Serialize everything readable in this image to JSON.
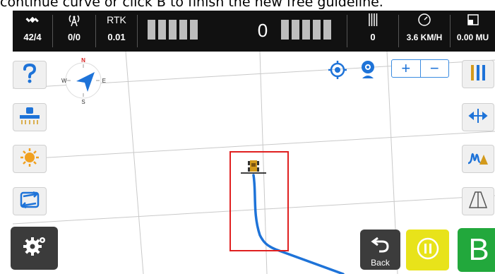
{
  "instruction": "continue curve or click B to finish the new free guideline.",
  "status_bar": {
    "satellites": "42/4",
    "signal": "0/0",
    "rtk_label": "RTK",
    "rtk_value": "0.01",
    "offset_center": "0",
    "row_count": "0",
    "speed": "3.6 KM/H",
    "area": "0.00 MU"
  },
  "map_toolbar": {
    "zoom_in": "+",
    "zoom_out": "−"
  },
  "compass": {
    "north": "N",
    "east": "E",
    "south": "S",
    "west": "W"
  },
  "bottom_controls": {
    "back_label": "Back",
    "b_label": "B"
  },
  "colors": {
    "track": "#1e73d8",
    "selection": "#e02020",
    "pause_bg": "#e8e31a",
    "b_bg": "#22a83c"
  },
  "icons": {
    "left_panel": [
      "help-icon",
      "implement-icon",
      "brightness-icon",
      "guideline-switch-icon",
      "settings-gear-icon"
    ],
    "right_panel": [
      "lightbar-icon",
      "offset-icon",
      "signal-wave-icon",
      "perspective-icon"
    ],
    "map": [
      "locate-icon",
      "webcam-icon",
      "tractor-icon"
    ]
  }
}
